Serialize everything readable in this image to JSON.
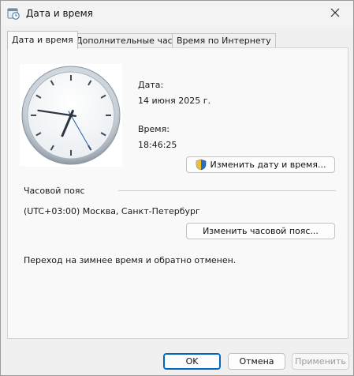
{
  "window": {
    "title": "Дата и время",
    "title_icon": "calendar-clock-icon",
    "close_icon": "close-icon"
  },
  "tabs": [
    {
      "label": "Дата и время",
      "active": true
    },
    {
      "label": "Дополнительные часы",
      "active": false
    },
    {
      "label": "Время по Интернету",
      "active": false
    }
  ],
  "datetime": {
    "date_label": "Дата:",
    "date_value": "14 июня 2025 г.",
    "time_label": "Время:",
    "time_value": "18:46:25",
    "change_button": "Изменить дату и время...",
    "change_button_icon": "uac-shield-icon",
    "clock_time": {
      "hour": 18,
      "minute": 46,
      "second": 25
    }
  },
  "timezone": {
    "section_label": "Часовой пояс",
    "value": "(UTC+03:00) Москва, Санкт-Петербург",
    "change_button": "Изменить часовой пояс..."
  },
  "dst_note": "Переход на зимнее время и обратно отменен.",
  "footer": {
    "ok": "OK",
    "cancel": "Отмена",
    "apply": "Применить"
  },
  "colors": {
    "accent": "#0067c0",
    "panel_bg": "#f9f9f9",
    "window_bg": "#f0f0f0"
  }
}
